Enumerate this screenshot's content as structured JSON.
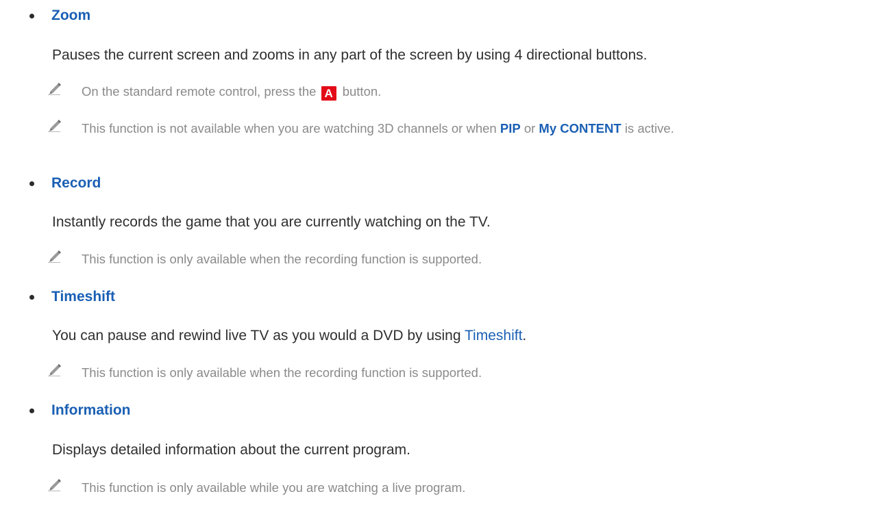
{
  "sections": [
    {
      "title": "Zoom",
      "desc": "Pauses the current screen and zooms in any part of the screen by using 4 directional buttons.",
      "notes": [
        {
          "before": "On the standard remote control, press the",
          "key": "A",
          "after": "button."
        },
        {
          "before": "This function is not available when you are watching 3D channels or when",
          "kw1": "PIP",
          "mid": "or",
          "kw2": "My CONTENT",
          "after": "is active."
        }
      ]
    },
    {
      "title": "Record",
      "desc": "Instantly records the game that you are currently watching on the TV.",
      "notes": [
        {
          "text": "This function is only available when the recording function is supported."
        }
      ]
    },
    {
      "title": "Timeshift",
      "desc_before": "You can pause and rewind live TV as you would a DVD by using",
      "desc_kw": "Timeshift",
      "desc_after": ".",
      "notes": [
        {
          "text": "This function is only available when the recording function is supported."
        }
      ]
    },
    {
      "title": "Information",
      "desc": "Displays detailed information about the current program.",
      "notes": [
        {
          "text": "This function is only available while you are watching a live program."
        }
      ]
    }
  ],
  "colors": {
    "keyword": "#1a5fb4",
    "body_text": "#2f2f2f",
    "note_text": "#8a8a8a",
    "remote_key_a": "#e30b17"
  },
  "icons": {
    "note": "pencil-icon",
    "bullet": "bullet-dot",
    "remote_key": "remote-a-key-icon"
  }
}
